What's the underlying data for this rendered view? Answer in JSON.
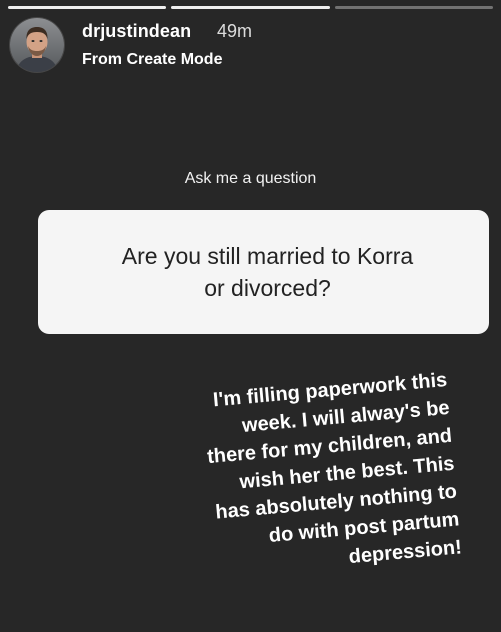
{
  "story": {
    "progress_segments": 3,
    "progress_active_index": 1,
    "header": {
      "username": "drjustindean",
      "time_ago": "49m",
      "subtitle": "From Create Mode"
    },
    "question_sticker": {
      "prompt_label": "Ask me a question",
      "question_lines": [
        "Are you still married to Korra",
        "or divorced?"
      ]
    },
    "answer_lines": [
      "I'm filling paperwork this",
      "week. I will alway's be",
      "there for my children, and",
      "wish her the best.  This",
      "has absolutely nothing to",
      "do with post partum",
      "depression!"
    ]
  },
  "colors": {
    "background": "#272727",
    "card": "#f5f5f5",
    "card_text": "#222222",
    "text": "#ffffff"
  }
}
